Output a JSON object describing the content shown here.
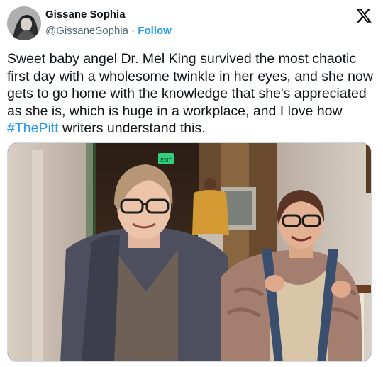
{
  "author": {
    "display_name": "Gissane Sophia",
    "handle": "@GissaneSophia",
    "separator": " · ",
    "follow_label": "Follow"
  },
  "platform_icon": "x-logo-icon",
  "tweet": {
    "text_before": "Sweet baby angel Dr. Mel King survived the most chaotic first day with a wholesome twinkle in her eyes, and she now gets to go home with the knowledge that she's appreciated as she is, which is huge in a workplace, and I love how ",
    "hashtag": "#ThePitt",
    "text_after": " writers understand this."
  },
  "media": {
    "icon": "photo-image",
    "exit_sign_text": "EXIT"
  },
  "colors": {
    "accent": "#1d9bf0",
    "text": "#0f1419",
    "secondary": "#536471"
  }
}
